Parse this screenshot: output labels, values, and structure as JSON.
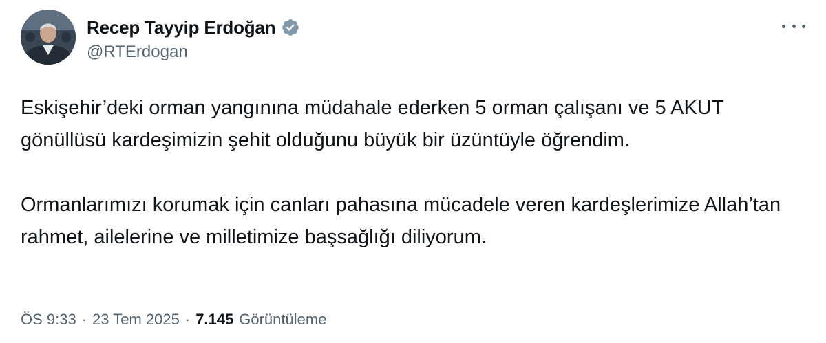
{
  "author": {
    "display_name": "Recep Tayyip Erdoğan",
    "handle": "@RTErdogan",
    "verified": true,
    "avatar_icon": "profile-photo",
    "verified_icon": "verified-badge-icon",
    "verified_color": "#829aab"
  },
  "tweet": {
    "paragraphs": [
      "Eskişehir’deki orman yangınına müdahale ederken 5 orman çalışanı ve 5 AKUT gönüllüsü kardeşimizin şehit olduğunu büyük bir üzüntüyle öğrendim.",
      "Ormanlarımızı korumak için canları pahasına mücadele veren kardeşlerimize Allah’tan rahmet, ailelerine ve milletimize başsağlığı diliyorum."
    ]
  },
  "meta": {
    "time": "ÖS 9:33",
    "separator": "·",
    "date": "23 Tem 2025",
    "views_count": "7.145",
    "views_label": "Görüntüleme"
  },
  "actions": {
    "more_icon": "more-options-icon"
  },
  "colors": {
    "text_primary": "#0f1419",
    "text_secondary": "#536471",
    "background": "#ffffff"
  }
}
